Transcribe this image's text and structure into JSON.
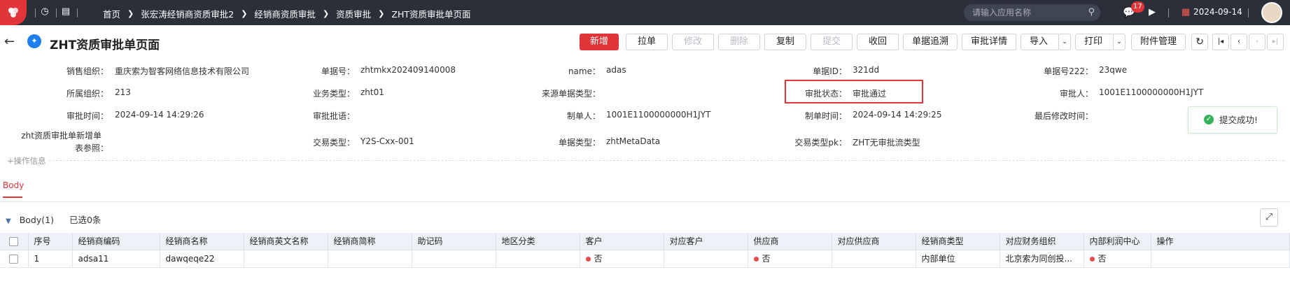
{
  "topbar": {
    "breadcrumbs": [
      "首页",
      "张宏涛经销商资质审批2",
      "经销商资质审批",
      "资质审批",
      "ZHT资质审批单页面"
    ],
    "search_placeholder": "请输入应用名称",
    "notification_count": "17",
    "date": "2024-09-14"
  },
  "page": {
    "title": "ZHT资质审批单页面"
  },
  "toolbar": {
    "buttons": [
      "新增",
      "拉单",
      "修改",
      "删除",
      "复制",
      "提交",
      "收回",
      "单据追溯",
      "审批详情",
      "导入",
      "打印",
      "附件管理"
    ]
  },
  "form": {
    "fields": [
      {
        "label": "销售组织：",
        "value": "重庆索为智客网络信息技术有限公司"
      },
      {
        "label": "单据号：",
        "value": "zhtmkx202409140008"
      },
      {
        "label": "name：",
        "value": "adas"
      },
      {
        "label": "单据ID：",
        "value": "321dd"
      },
      {
        "label": "单据号222：",
        "value": "23qwe"
      },
      {
        "label": "所属组织：",
        "value": "213"
      },
      {
        "label": "业务类型：",
        "value": "zht01"
      },
      {
        "label": "来源单据类型：",
        "value": ""
      },
      {
        "label": "审批状态：",
        "value": "审批通过"
      },
      {
        "label": "审批人：",
        "value": "1001E1100000000H1JYT"
      },
      {
        "label": "审批时间：",
        "value": "2024-09-14 14:29:26"
      },
      {
        "label": "审批批语：",
        "value": ""
      },
      {
        "label": "制单人：",
        "value": "1001E1100000000H1JYT"
      },
      {
        "label": "制单时间：",
        "value": "2024-09-14 14:29:25"
      },
      {
        "label": "最后修改时间：",
        "value": ""
      },
      {
        "label": "zht资质审批单新增单",
        "value": ""
      },
      {
        "label": "表参照：",
        "value": ""
      },
      {
        "label": "交易类型：",
        "value": "Y2S-Cxx-001"
      },
      {
        "label": "单据类型：",
        "value": "zhtMetaData"
      },
      {
        "label": "交易类型pk：",
        "value": "ZHT无审批流类型"
      }
    ],
    "ops_label": "+操作信息"
  },
  "tabs": {
    "active": "Body"
  },
  "section": {
    "title": "Body(1)",
    "selected": "已选0条"
  },
  "table": {
    "headers": [
      "序号",
      "经销商编码",
      "经销商名称",
      "经销商英文名称",
      "经销商简称",
      "助记码",
      "地区分类",
      "客户",
      "对应客户",
      "供应商",
      "对应供应商",
      "经销商类型",
      "对应财务组织",
      "内部利润中心",
      "操作"
    ],
    "rows": [
      [
        "1",
        "adsa11",
        "dawqeqe22",
        "",
        "",
        "",
        "",
        "否",
        "",
        "否",
        "",
        "内部单位",
        "北京索为同创投...",
        "否",
        ""
      ]
    ]
  },
  "toast": {
    "message": "提交成功!"
  },
  "colors": {
    "accent": "#e1353a",
    "topbar_bg": "#2b2f3a",
    "success": "#36b35a"
  }
}
